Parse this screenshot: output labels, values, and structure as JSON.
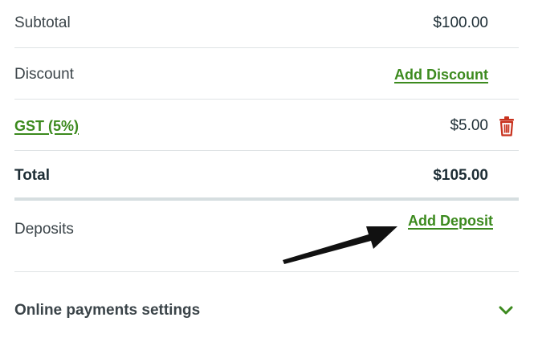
{
  "summary": {
    "subtotal": {
      "label": "Subtotal",
      "value": "$100.00"
    },
    "discount": {
      "label": "Discount",
      "action": "Add Discount"
    },
    "tax": {
      "label": "GST (5%)",
      "value": "$5.00",
      "delete_icon": "trash-icon"
    },
    "total": {
      "label": "Total",
      "value": "$105.00"
    }
  },
  "deposits": {
    "label": "Deposits",
    "action": "Add Deposit"
  },
  "online_payments": {
    "label": "Online payments settings",
    "toggle_icon": "chevron-down-icon"
  },
  "colors": {
    "link": "#3c8a1e",
    "delete": "#c8321e",
    "text": "#3b4449",
    "strong_text": "#1d2d35",
    "divider": "#dfe3e5"
  }
}
